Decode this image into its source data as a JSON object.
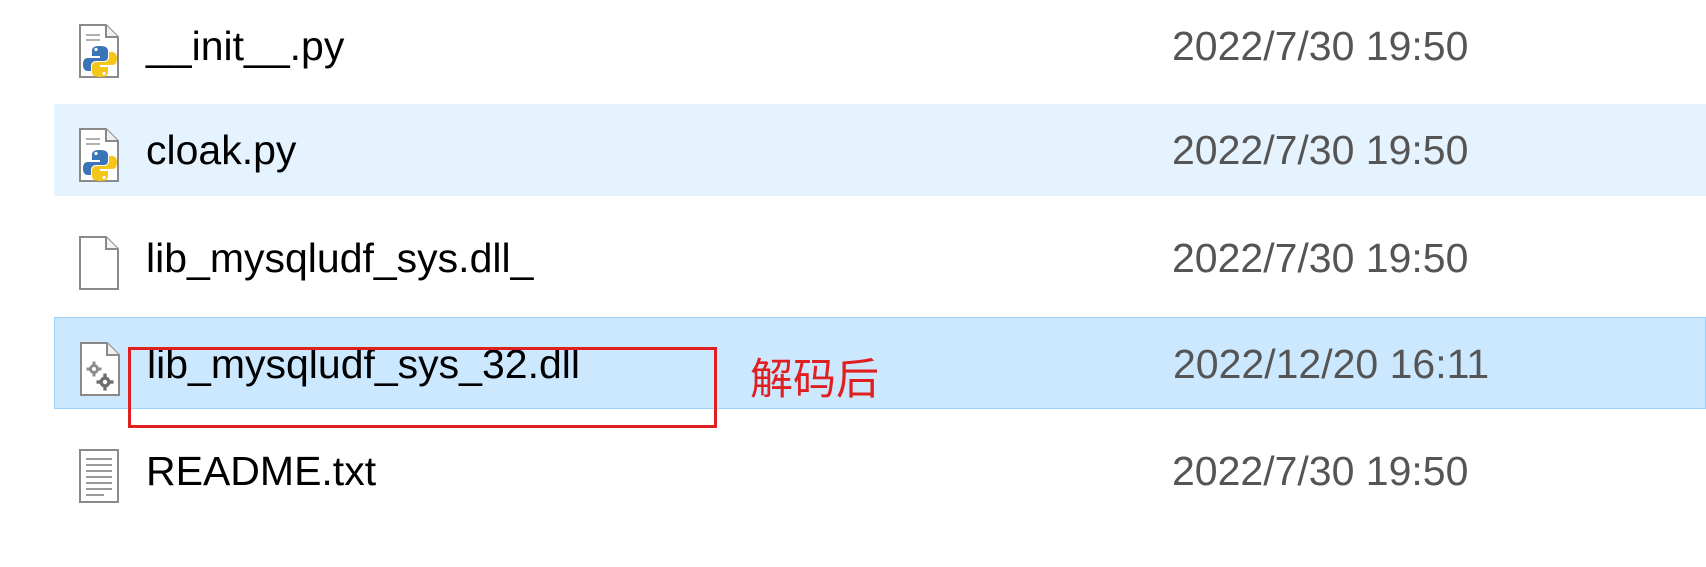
{
  "files": [
    {
      "name": "__init__.py",
      "modified": "2022/7/30 19:50",
      "icon": "python-file-icon",
      "state": "normal"
    },
    {
      "name": "cloak.py",
      "modified": "2022/7/30 19:50",
      "icon": "python-file-icon",
      "state": "hover"
    },
    {
      "name": "lib_mysqludf_sys.dll_",
      "modified": "2022/7/30 19:50",
      "icon": "blank-file-icon",
      "state": "normal"
    },
    {
      "name": "lib_mysqludf_sys_32.dll",
      "modified": "2022/12/20 16:11",
      "icon": "dll-file-icon",
      "state": "selected"
    },
    {
      "name": "README.txt",
      "modified": "2022/7/30 19:50",
      "icon": "text-file-icon",
      "state": "normal"
    }
  ],
  "annotation": {
    "text": "解码后",
    "color": "#e02020"
  },
  "colors": {
    "hover_background": "#e5f3ff",
    "selected_background": "#cce8ff",
    "selected_border": "#99d1ff",
    "date_text": "#555555"
  }
}
